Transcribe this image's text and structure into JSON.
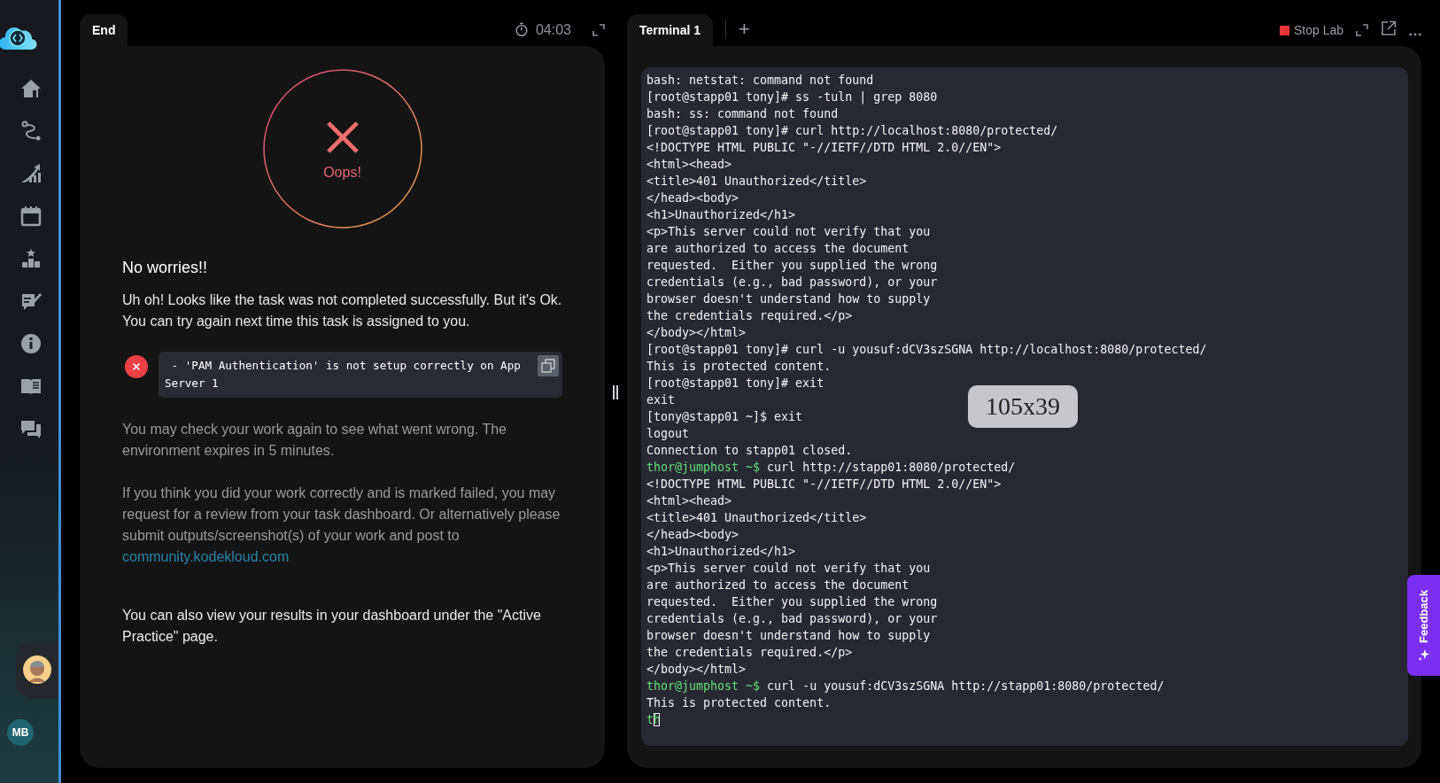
{
  "sidebar": {
    "user_initials": "MB"
  },
  "left_panel": {
    "tabs": [
      {
        "label": "End",
        "selected": true
      }
    ],
    "timer": "04:03",
    "result": {
      "label": "Oops!"
    },
    "heading": "No worries!!",
    "message": "Uh oh! Looks like the task was not completed successfully. But it's Ok. You can try again next time this task is assigned to you.",
    "errors": [
      {
        "text": " - 'PAM Authentication' is not setup correctly on App Server 1"
      }
    ],
    "note": "You may check your work again to see what went wrong. The environment expires in 5 minutes.",
    "review_note": "If you think you did your work correctly and is marked failed, you may request for a review from your task dashboard. Or alternatively please submit outputs/screenshot(s) of your work and post to",
    "link": "community.kodekloud.com",
    "footer_note": "You can also view your results in your dashboard under the \"Active Practice\" page."
  },
  "terminal": {
    "tabs": [
      {
        "label": "Terminal 1",
        "selected": true
      }
    ],
    "add_tab": "+",
    "stop_button": "Stop Lab",
    "lines": [
      {
        "kind": "output",
        "text": "bash: netstat: command not found"
      },
      {
        "kind": "output",
        "text": "[root@stapp01 tony]# ss -tuln | grep 8080"
      },
      {
        "kind": "output",
        "text": "bash: ss: command not found"
      },
      {
        "kind": "output",
        "text": "[root@stapp01 tony]# curl http://localhost:8080/protected/"
      },
      {
        "kind": "output",
        "text": "<!DOCTYPE HTML PUBLIC \"-//IETF//DTD HTML 2.0//EN\">"
      },
      {
        "kind": "output",
        "text": "<html><head>"
      },
      {
        "kind": "output",
        "text": "<title>401 Unauthorized</title>"
      },
      {
        "kind": "output",
        "text": "</head><body>"
      },
      {
        "kind": "output",
        "text": "<h1>Unauthorized</h1>"
      },
      {
        "kind": "output",
        "text": "<p>This server could not verify that you"
      },
      {
        "kind": "output",
        "text": "are authorized to access the document"
      },
      {
        "kind": "output",
        "text": "requested.  Either you supplied the wrong"
      },
      {
        "kind": "output",
        "text": "credentials (e.g., bad password), or your"
      },
      {
        "kind": "output",
        "text": "browser doesn't understand how to supply"
      },
      {
        "kind": "output",
        "text": "the credentials required.</p>"
      },
      {
        "kind": "output",
        "text": "</body></html>"
      },
      {
        "kind": "output",
        "text": "[root@stapp01 tony]# curl -u yousuf:dCV3szSGNA http://localhost:8080/protected/"
      },
      {
        "kind": "output",
        "text": "This is protected content."
      },
      {
        "kind": "output",
        "text": "[root@stapp01 tony]# exit"
      },
      {
        "kind": "output",
        "text": "exit"
      },
      {
        "kind": "output",
        "text": "[tony@stapp01 ~]$ exit"
      },
      {
        "kind": "output",
        "text": "logout"
      },
      {
        "kind": "output",
        "text": "Connection to stapp01 closed."
      },
      {
        "kind": "prompt",
        "prompt": "thor@jumphost ~$",
        "text": " curl http://stapp01:8080/protected/"
      },
      {
        "kind": "output",
        "text": "<!DOCTYPE HTML PUBLIC \"-//IETF//DTD HTML 2.0//EN\">"
      },
      {
        "kind": "output",
        "text": "<html><head>"
      },
      {
        "kind": "output",
        "text": "<title>401 Unauthorized</title>"
      },
      {
        "kind": "output",
        "text": "</head><body>"
      },
      {
        "kind": "output",
        "text": "<h1>Unauthorized</h1>"
      },
      {
        "kind": "output",
        "text": "<p>This server could not verify that you"
      },
      {
        "kind": "output",
        "text": "are authorized to access the document"
      },
      {
        "kind": "output",
        "text": "requested.  Either you supplied the wrong"
      },
      {
        "kind": "output",
        "text": "credentials (e.g., bad password), or your"
      },
      {
        "kind": "output",
        "text": "browser doesn't understand how to supply"
      },
      {
        "kind": "output",
        "text": "the credentials required.</p>"
      },
      {
        "kind": "output",
        "text": "</body></html>"
      },
      {
        "kind": "prompt",
        "prompt": "thor@jumphost ~$",
        "text": " curl -u yousuf:dCV3szSGNA http://stapp01:8080/protected/"
      },
      {
        "kind": "output",
        "text": "This is protected content."
      },
      {
        "kind": "input",
        "text": "th"
      }
    ],
    "size_tooltip": "105x39"
  },
  "feedback_button": "Feedback"
}
